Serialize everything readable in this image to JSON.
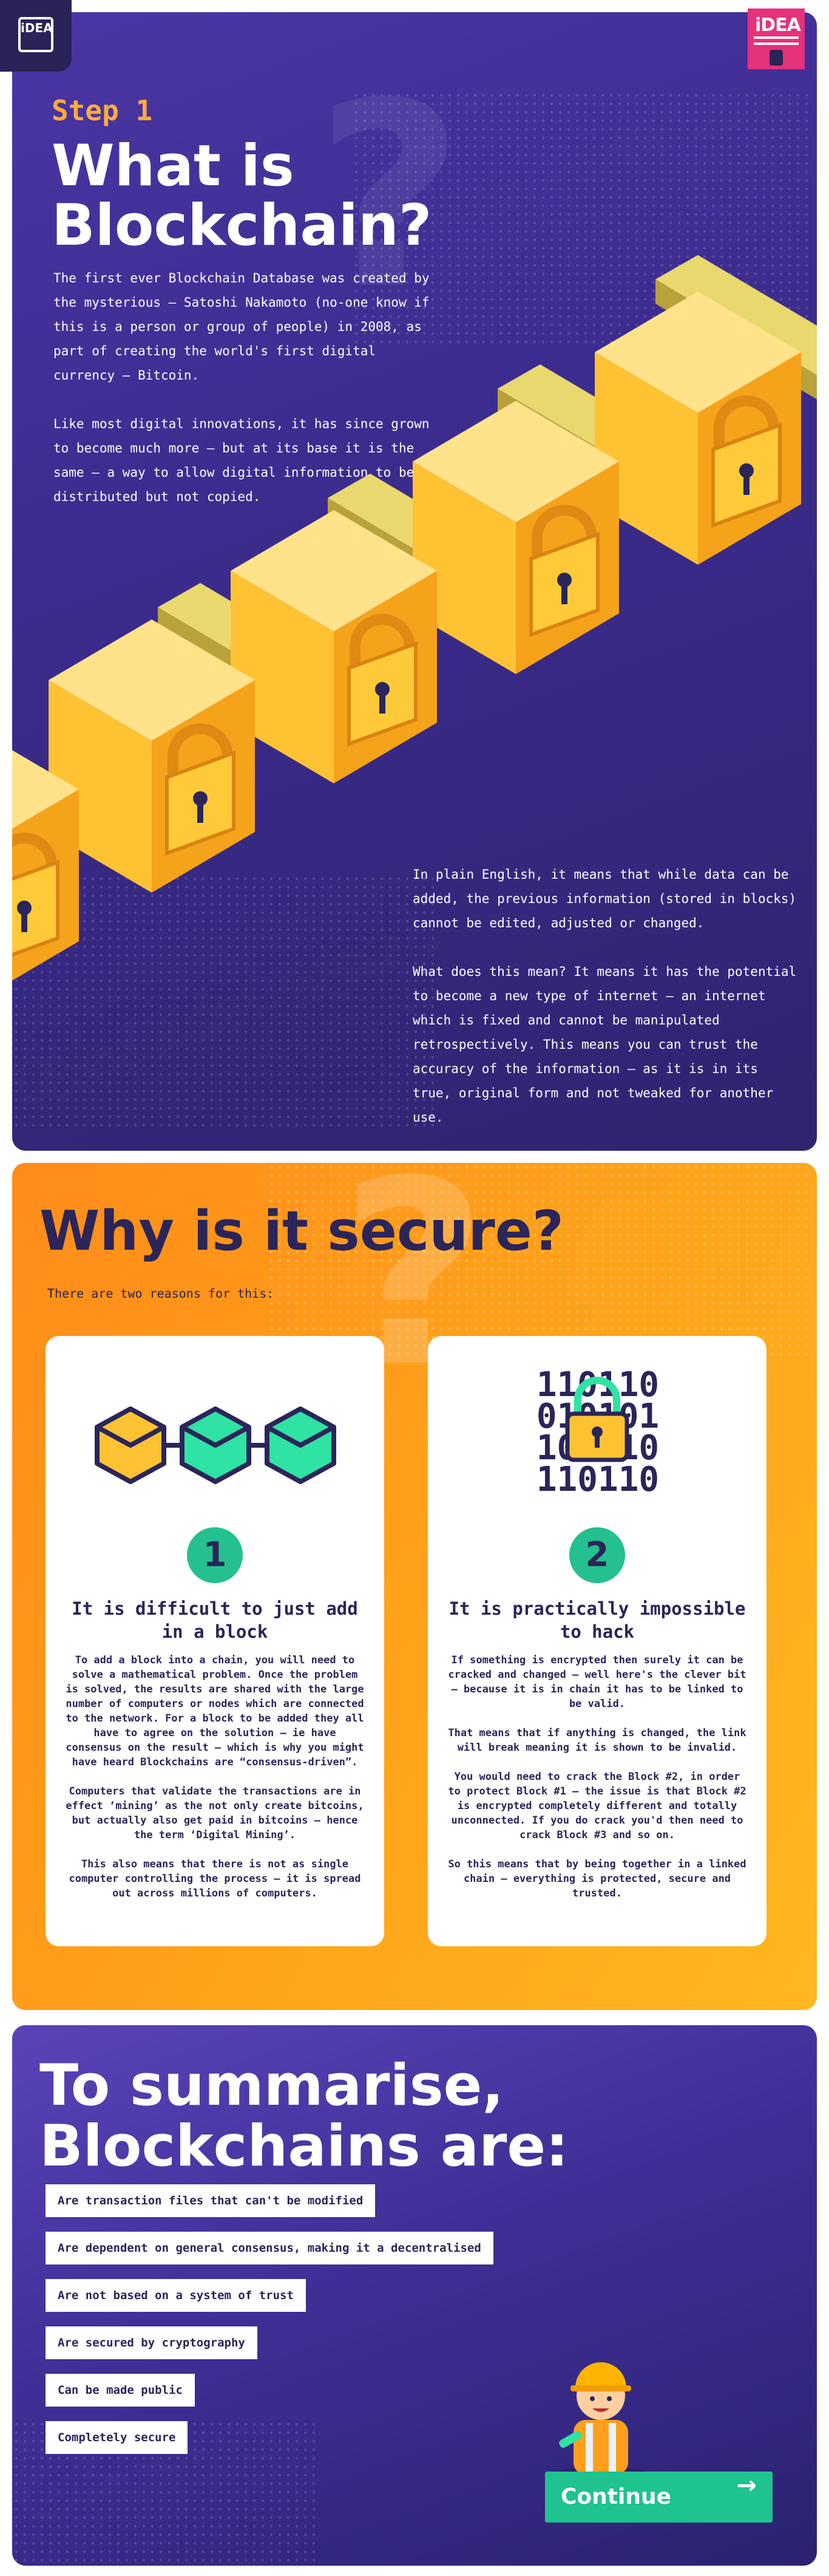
{
  "logos": {
    "left_text": "iDEA",
    "right_text": "iDEA"
  },
  "section1": {
    "step_label": "Step 1",
    "title": "What is Blockchain?",
    "paragraphs_top": [
      "The first ever Blockchain Database was created by the mysterious – Satoshi Nakamoto (no-one know if this is a person or group of people) in 2008, as part of creating the world's first digital currency – Bitcoin.",
      "Like most digital innovations, it has since grown to become much more – but at its base it is the same – a way to allow digital information to be distributed but not copied."
    ],
    "paragraphs_bottom": [
      "In plain English, it means that while data can be added, the previous information (stored in blocks) cannot be edited, adjusted or changed.",
      "What does this mean? It means it has the potential to become a new type of internet – an internet which is fixed and cannot be manipulated retrospectively. This means you can trust the accuracy of the information – as it is in its true, original form and not tweaked for another use."
    ]
  },
  "section2": {
    "title": "Why is it secure?",
    "subtitle": "There are two reasons for this:",
    "cards": [
      {
        "number": "1",
        "title": "It is difficult to just add in a block",
        "paragraphs": [
          "To add a block into a chain, you will need to solve a mathematical problem.  Once the problem is solved, the results are shared with the large number of computers or nodes which are connected to the network. For a block to be added they all have to agree on the solution – ie have consensus on the result – which is why you might have heard Blockchains are “consensus-driven”.",
          "Computers that validate the transactions are in effect ‘mining’ as the not only create bitcoins, but actually also get paid in bitcoins – hence the term ‘Digital Mining’.",
          "This also means that there is not as single computer controlling the process – it is spread out across millions of computers."
        ]
      },
      {
        "number": "2",
        "title": "It is practically impossible to hack",
        "binary_lines": [
          "110110",
          "010101",
          "101010",
          "110110"
        ],
        "paragraphs": [
          "If something is encrypted then surely it can be cracked and changed – well here's the clever bit – because it is in chain it has to be linked to be valid.",
          "That means that if anything is changed, the link will break meaning it is shown to be invalid.",
          "You would need to crack the Block #2, in order to protect Block #1 – the issue is that Block #2 is encrypted completely different and totally unconnected. If you do crack you'd then need to crack Block #3 and so on.",
          "So this means that by being together in a linked chain – everything is protected, secure and trusted."
        ]
      }
    ]
  },
  "section3": {
    "title": "To summarise, Blockchains are:",
    "items": [
      "Are transaction files that can't be modified",
      "Are dependent on general consensus, making it a decentralised",
      "Are not based on a system of trust",
      "Are secured by cryptography",
      "Can be made public",
      "Completely secure"
    ],
    "continue_label": "Continue",
    "continue_arrow": "→"
  },
  "colors": {
    "purple": "#3c2c8e",
    "orange": "#ffa41a",
    "navy": "#2b2559",
    "green": "#1ec38f",
    "gold": "#ffb52e"
  }
}
